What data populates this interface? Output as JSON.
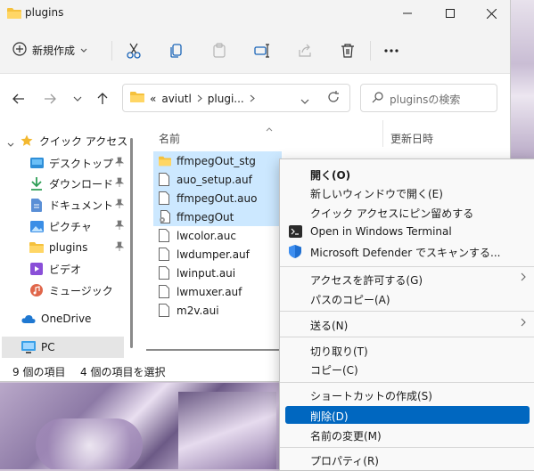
{
  "window": {
    "title": "plugins"
  },
  "toolbar": {
    "new_label": "新規作成"
  },
  "address": {
    "root_label": "«",
    "crumbs": [
      "aviutl",
      "plugi..."
    ]
  },
  "search": {
    "placeholder": "pluginsの検索"
  },
  "sidebar": {
    "items": [
      {
        "label": "クイック アクセス",
        "icon": "star-icon"
      },
      {
        "label": "デスクトップ",
        "icon": "desktop-icon",
        "pinned": true
      },
      {
        "label": "ダウンロード",
        "icon": "download-icon",
        "pinned": true
      },
      {
        "label": "ドキュメント",
        "icon": "document-icon",
        "pinned": true
      },
      {
        "label": "ピクチャ",
        "icon": "picture-icon",
        "pinned": true
      },
      {
        "label": "plugins",
        "icon": "folder-icon",
        "pinned": true
      },
      {
        "label": "ビデオ",
        "icon": "video-icon"
      },
      {
        "label": "ミュージック",
        "icon": "music-icon"
      },
      {
        "label": "OneDrive",
        "icon": "cloud-icon"
      },
      {
        "label": "PC",
        "icon": "pc-icon"
      }
    ]
  },
  "columns": {
    "name": "名前",
    "date": "更新日時"
  },
  "files": [
    {
      "name": "ffmpegOut_stg",
      "type": "folder",
      "selected": true
    },
    {
      "name": "auo_setup.auf",
      "type": "file",
      "selected": true
    },
    {
      "name": "ffmpegOut.auo",
      "type": "file",
      "selected": true
    },
    {
      "name": "ffmpegOut",
      "type": "settings",
      "selected": true
    },
    {
      "name": "lwcolor.auc",
      "type": "file",
      "selected": false
    },
    {
      "name": "lwdumper.auf",
      "type": "file",
      "selected": false
    },
    {
      "name": "lwinput.aui",
      "type": "file",
      "selected": false
    },
    {
      "name": "lwmuxer.auf",
      "type": "file",
      "selected": false
    },
    {
      "name": "m2v.aui",
      "type": "file",
      "selected": false
    }
  ],
  "status": {
    "count": "9 個の項目",
    "selected": "4 個の項目を選択"
  },
  "context_menu": {
    "items": [
      {
        "label": "開く(O)",
        "bold": true
      },
      {
        "label": "新しいウィンドウで開く(E)"
      },
      {
        "label": "クイック アクセスにピン留めする"
      },
      {
        "label": "Open in Windows Terminal",
        "icon": "terminal-icon"
      },
      {
        "label": "Microsoft Defender でスキャンする...",
        "icon": "defender-shield-icon"
      },
      {
        "label": "アクセスを許可する(G)",
        "submenu": true
      },
      {
        "label": "パスのコピー(A)"
      },
      {
        "label": "送る(N)",
        "submenu": true
      },
      {
        "label": "切り取り(T)"
      },
      {
        "label": "コピー(C)"
      },
      {
        "label": "ショートカットの作成(S)"
      },
      {
        "label": "削除(D)",
        "highlighted": true
      },
      {
        "label": "名前の変更(M)"
      },
      {
        "label": "プロパティ(R)"
      }
    ]
  }
}
